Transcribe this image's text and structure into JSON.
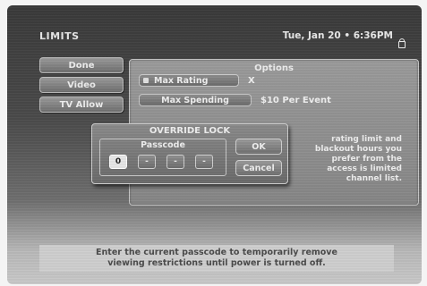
{
  "screen": {
    "title": "LIMITS",
    "datetime": "Tue, Jan 20 • 6:36PM"
  },
  "sidebar": {
    "items": [
      {
        "label": "Done"
      },
      {
        "label": "Video"
      },
      {
        "label": "TV Allow"
      }
    ]
  },
  "options": {
    "title": "Options",
    "max_rating_label": "Max Rating",
    "max_rating_value": "X",
    "max_spending_label": "Max Spending",
    "max_spending_value": "$10 Per Event",
    "description_lines": [
      "rating limit and",
      "blackout hours you",
      "prefer from the",
      "access is limited",
      "channel list."
    ]
  },
  "dialog": {
    "title": "OVERRIDE LOCK",
    "passcode_label": "Passcode",
    "digits": [
      "0",
      "-",
      "-",
      "-"
    ],
    "ok_label": "OK",
    "cancel_label": "Cancel"
  },
  "hint": {
    "line1": "Enter the current passcode to temporarily remove",
    "line2": "viewing restrictions until power is turned off."
  },
  "icons": {
    "lock": "lock-icon",
    "option_marker": "square-bullet-icon"
  },
  "colors": {
    "panel": "#8e8e8e",
    "text": "#ececec",
    "hint_bg": "#cfcfcf"
  }
}
